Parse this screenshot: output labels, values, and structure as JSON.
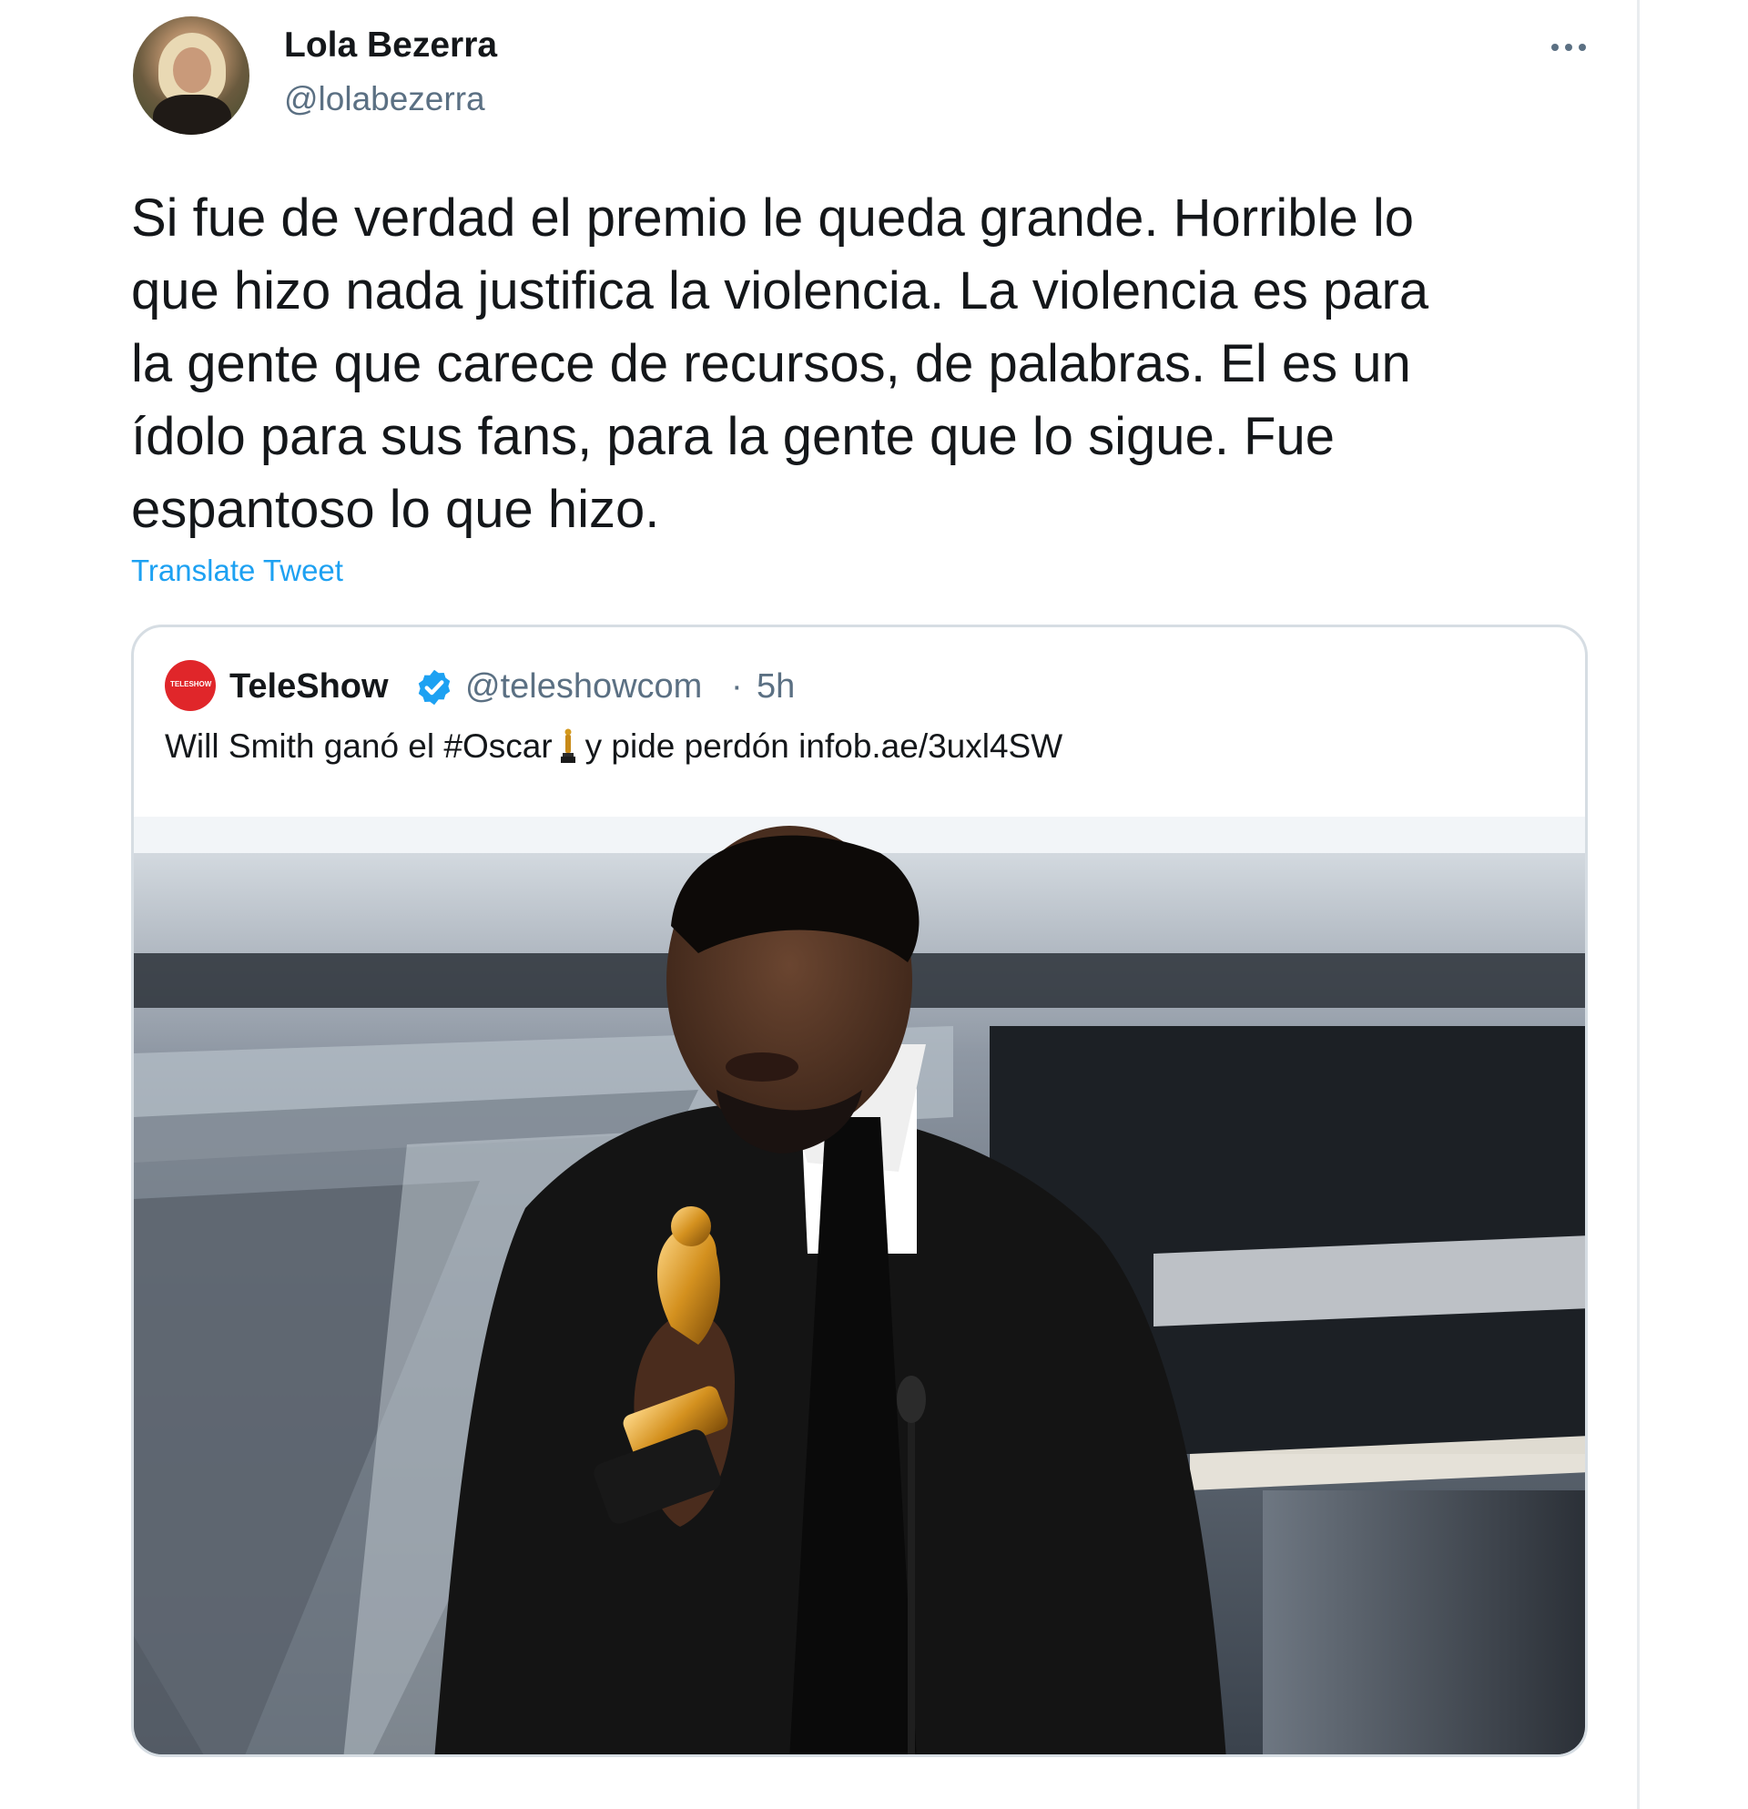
{
  "tweet": {
    "author": {
      "display_name": "Lola Bezerra",
      "handle": "@lolabezerra"
    },
    "text_lines": [
      "Si fue de verdad el premio le queda grande. Horrible lo",
      "que hizo nada justifica la violencia. La violencia es para",
      "la gente que carece de recursos, de palabras. El es un",
      "ídolo para sus fans, para la gente que lo sigue. Fue",
      "espantoso lo que hizo."
    ],
    "translate_label": "Translate Tweet",
    "more_icon": "more-horizontal-icon"
  },
  "quoted_tweet": {
    "author": {
      "display_name": "TeleShow",
      "handle": "@teleshowcom",
      "verified": true,
      "avatar_text": "TELESHOW"
    },
    "separator": "·",
    "time": "5h",
    "text_before_icon": "Will Smith ganó el #Oscar",
    "text_icon": "oscar-statuette-icon",
    "text_after_icon": "y pide perdón infob.ae/3uxl4SW"
  },
  "colors": {
    "text_primary": "#14171a",
    "text_secondary": "#5b7083",
    "link": "#1da1f2",
    "verified": "#1da1f2",
    "card_border": "#d6dde3",
    "teleshow_red": "#e0262a"
  }
}
